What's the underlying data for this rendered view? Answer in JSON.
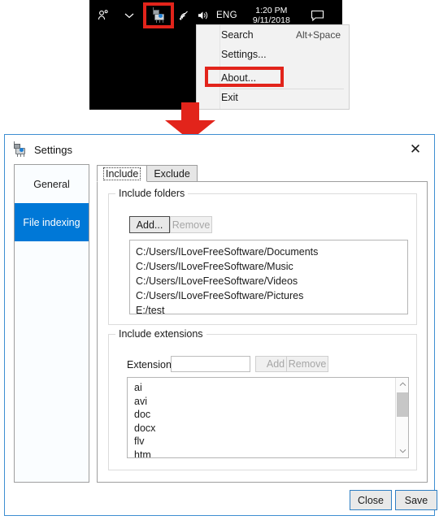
{
  "taskbar": {
    "people_icon": "people-icon",
    "chevron_icon": "chevron-up-icon",
    "app_icon": "app-tray-icon",
    "wifi_icon": "wifi-icon",
    "volume_icon": "volume-icon",
    "language": "ENG",
    "time": "1:20 PM",
    "date": "9/11/2018",
    "action_center_icon": "action-center-icon",
    "highlight_color": "#e2241b"
  },
  "context_menu": {
    "items": [
      {
        "label": "Search",
        "accel": "Alt+Space"
      },
      {
        "label": "Settings...",
        "accel": ""
      },
      {
        "label": "About...",
        "accel": ""
      },
      {
        "label": "Exit",
        "accel": ""
      }
    ],
    "highlighted_item": "Settings..."
  },
  "arrow": {
    "name": "red-down-arrow",
    "color": "#e2241b"
  },
  "dialog": {
    "title": "Settings",
    "icon": "app-window-icon",
    "close_label": "✕",
    "accent_color": "#0078d7",
    "border_color": "#3f8fd2",
    "sidebar": {
      "items": [
        {
          "label": "General",
          "selected": false
        },
        {
          "label": "File indexing",
          "selected": true
        }
      ]
    },
    "tabs": [
      {
        "label": "Include",
        "active": true
      },
      {
        "label": "Exclude",
        "active": false
      }
    ],
    "include_folders": {
      "group_title": "Include folders",
      "add_label": "Add...",
      "remove_label": "Remove",
      "remove_disabled": true,
      "items": [
        "C:/Users/ILoveFreeSoftware/Documents",
        "C:/Users/ILoveFreeSoftware/Music",
        "C:/Users/ILoveFreeSoftware/Videos",
        "C:/Users/ILoveFreeSoftware/Pictures",
        "E:/test"
      ]
    },
    "include_extensions": {
      "group_title": "Include extensions",
      "extension_label": "Extension:",
      "extension_value": "",
      "extension_placeholder": "",
      "add_label": "Add",
      "remove_label": "Remove",
      "add_disabled": true,
      "remove_disabled": true,
      "items": [
        "ai",
        "avi",
        "doc",
        "docx",
        "flv",
        "htm"
      ],
      "scroll_up_icon": "chevron-up-icon",
      "scroll_down_icon": "chevron-down-icon"
    },
    "footer": {
      "close_label": "Close",
      "save_label": "Save"
    }
  }
}
